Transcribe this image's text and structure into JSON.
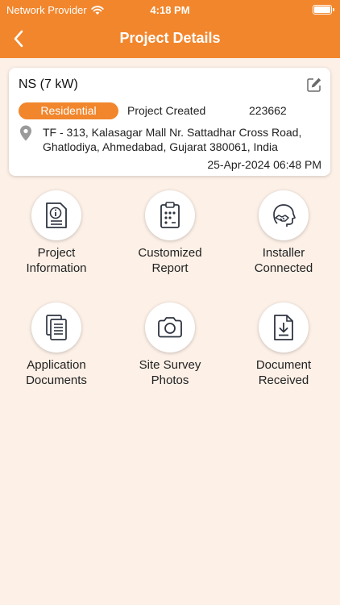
{
  "status_bar": {
    "carrier": "Network Provider",
    "time": "4:18 PM"
  },
  "header": {
    "title": "Project Details",
    "background_color": "#F2862C"
  },
  "project": {
    "name": "NS (7 kW)",
    "category": "Residential",
    "status": "Project Created",
    "id": "223662",
    "address_line1": "TF - 313, Kalasagar Mall Nr. Sattadhar Cross Road,",
    "address_line2": "Ghatlodiya, Ahmedabad, Gujarat 380061, India",
    "created_at": "25-Apr-2024 06:48 PM"
  },
  "tiles": [
    {
      "line1": "Project",
      "line2": "Information",
      "icon": "project-information-icon"
    },
    {
      "line1": "Customized",
      "line2": "Report",
      "icon": "customized-report-icon"
    },
    {
      "line1": "Installer",
      "line2": "Connected",
      "icon": "installer-connected-icon"
    },
    {
      "line1": "Application",
      "line2": "Documents",
      "icon": "application-documents-icon"
    },
    {
      "line1": "Site Survey",
      "line2": "Photos",
      "icon": "camera-icon"
    },
    {
      "line1": "Document",
      "line2": "Received",
      "icon": "document-received-icon"
    }
  ],
  "colors": {
    "accent": "#F2862C",
    "background": "#FCF0E7",
    "icon_stroke": "#2E3440"
  }
}
